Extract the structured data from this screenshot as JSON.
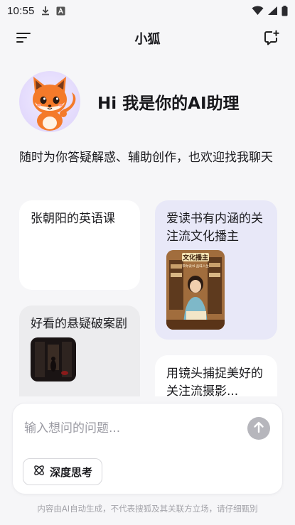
{
  "status_bar": {
    "time": "10:55",
    "icons": [
      "download-icon",
      "font-icon",
      "wifi-icon",
      "signal-icon",
      "battery-icon"
    ]
  },
  "header": {
    "title": "小狐",
    "menu_icon": "menu-icon",
    "new_chat_icon": "new-chat-icon"
  },
  "hero": {
    "avatar": "fox-avatar",
    "title": "Hi 我是你的AI助理"
  },
  "subtitle": "随时为你答疑解惑、辅助创作，也欢迎找我聊天",
  "cards": [
    {
      "label": "张朝阳的英语课"
    },
    {
      "label": "爱读书有内涵的关注流文化播主",
      "thumb_title": "文化播主",
      "thumb_sub": "带你读书·品味人生"
    },
    {
      "label": "好看的悬疑破案剧"
    },
    {
      "label": "用镜头捕捉美好的关注流摄影..."
    }
  ],
  "input": {
    "placeholder": "输入想问的问题...",
    "value": ""
  },
  "deep_think_label": "深度思考",
  "disclaimer": "内容由AI自动生成，不代表搜狐及其关联方立场，请仔细甄别",
  "colors": {
    "background": "#f6f6f8",
    "card_purple": "#e8e8f8",
    "card_gray": "#ececee",
    "send_button": "#b6b6bc",
    "avatar_bg": "#dcd1fb"
  }
}
